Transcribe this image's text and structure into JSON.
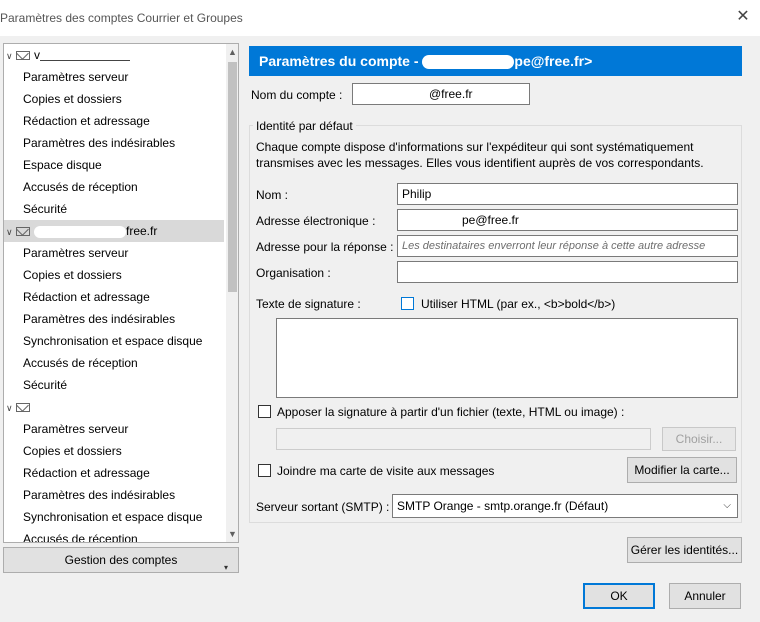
{
  "window": {
    "title": "Paramètres des comptes Courrier et Groupes",
    "close_glyph": "✕"
  },
  "sidebar": {
    "accounts": [
      {
        "label": "v",
        "items": [
          "Paramètres serveur",
          "Copies et dossiers",
          "Rédaction et adressage",
          "Paramètres des indésirables",
          "Espace disque",
          "Accusés de réception",
          "Sécurité"
        ]
      },
      {
        "label": "free.fr",
        "items": [
          "Paramètres serveur",
          "Copies et dossiers",
          "Rédaction et adressage",
          "Paramètres des indésirables",
          "Synchronisation et espace disque",
          "Accusés de réception",
          "Sécurité"
        ]
      },
      {
        "label": "",
        "items": [
          "Paramètres serveur",
          "Copies et dossiers",
          "Rédaction et adressage",
          "Paramètres des indésirables",
          "Synchronisation et espace disque",
          "Accusés de réception"
        ]
      }
    ],
    "manage_button": "Gestion des comptes",
    "manage_arrow": "▾"
  },
  "main": {
    "header_prefix": "Paramètres du compte - ",
    "header_email": "pe@free.fr>",
    "account_name_label": "Nom du compte :",
    "account_name_value": "@free.fr",
    "identity_legend": "Identité par défaut",
    "identity_desc_1": "Chaque compte dispose d'informations sur l'expéditeur qui sont systématiquement",
    "identity_desc_2": "transmises avec les messages. Elles vous identifient auprès de vos correspondants.",
    "name_label": "Nom :",
    "name_value": "Philip",
    "email_label": "Adresse électronique :",
    "email_value": "pe@free.fr",
    "reply_label": "Adresse pour la réponse :",
    "reply_placeholder": "Les destinataires enverront leur réponse à cette autre adresse",
    "org_label": "Organisation :",
    "org_value": "",
    "signature_label": "Texte de signature :",
    "use_html_label": "Utiliser HTML (par ex., <b>bold</b>)",
    "attach_sig_label": "Apposer la signature à partir d'un fichier (texte, HTML ou image) :",
    "choose_button": "Choisir...",
    "vcard_label": "Joindre ma carte de visite aux messages",
    "edit_card_button": "Modifier la carte...",
    "smtp_label": "Serveur sortant (SMTP) :",
    "smtp_value": "SMTP Orange - smtp.orange.fr (Défaut)",
    "manage_identities_button": "Gérer les identités...",
    "ok_button": "OK",
    "cancel_button": "Annuler"
  },
  "colors": {
    "header_bg": "#0078d7",
    "selection_bg": "#d9d9d9"
  }
}
